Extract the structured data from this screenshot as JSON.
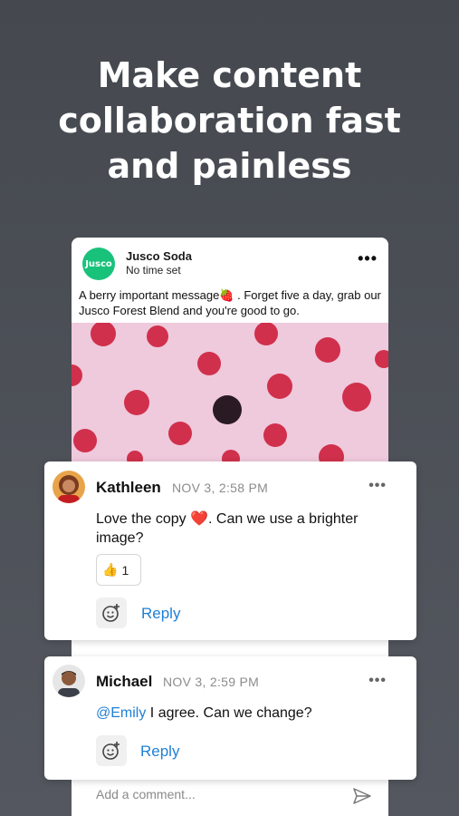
{
  "headline": [
    "Make content",
    "collaboration fast",
    "and painless"
  ],
  "post": {
    "brand_logo_text": "Jusco",
    "brand_name": "Jusco Soda",
    "time": "No time set",
    "text": "A berry important message🍓 . Forget five a day, grab our Jusco Forest Blend and you're good to go.",
    "more_icon": "more-horizontal-icon",
    "brand_color": "#19c27a"
  },
  "comments": [
    {
      "author": "Kathleen",
      "time": "NOV 3, 2:58 PM",
      "body": "Love the copy ❤️. Can we use a brighter image?",
      "reaction_emoji": "👍",
      "reaction_count": "1",
      "reply_label": "Reply"
    },
    {
      "author": "Michael",
      "time": "NOV 3, 2:59 PM",
      "mention": "@Emily",
      "body": " I agree. Can we change?",
      "reply_label": "Reply"
    }
  ],
  "add_comment_placeholder": "Add a comment...",
  "colors": {
    "accent": "#1f7fd6",
    "background": "#4a4e55"
  }
}
